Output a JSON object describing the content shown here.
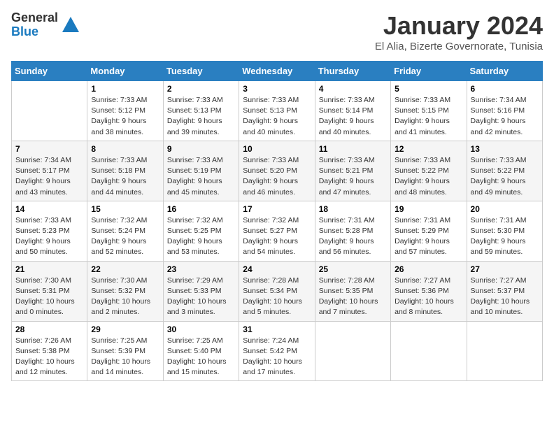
{
  "header": {
    "logo": {
      "general": "General",
      "blue": "Blue"
    },
    "title": "January 2024",
    "location": "El Alia, Bizerte Governorate, Tunisia"
  },
  "weekdays": [
    "Sunday",
    "Monday",
    "Tuesday",
    "Wednesday",
    "Thursday",
    "Friday",
    "Saturday"
  ],
  "weeks": [
    [
      {
        "day": "",
        "sunrise": "",
        "sunset": "",
        "daylight": "",
        "empty": true
      },
      {
        "day": "1",
        "sunrise": "Sunrise: 7:33 AM",
        "sunset": "Sunset: 5:12 PM",
        "daylight": "Daylight: 9 hours and 38 minutes."
      },
      {
        "day": "2",
        "sunrise": "Sunrise: 7:33 AM",
        "sunset": "Sunset: 5:13 PM",
        "daylight": "Daylight: 9 hours and 39 minutes."
      },
      {
        "day": "3",
        "sunrise": "Sunrise: 7:33 AM",
        "sunset": "Sunset: 5:13 PM",
        "daylight": "Daylight: 9 hours and 40 minutes."
      },
      {
        "day": "4",
        "sunrise": "Sunrise: 7:33 AM",
        "sunset": "Sunset: 5:14 PM",
        "daylight": "Daylight: 9 hours and 40 minutes."
      },
      {
        "day": "5",
        "sunrise": "Sunrise: 7:33 AM",
        "sunset": "Sunset: 5:15 PM",
        "daylight": "Daylight: 9 hours and 41 minutes."
      },
      {
        "day": "6",
        "sunrise": "Sunrise: 7:34 AM",
        "sunset": "Sunset: 5:16 PM",
        "daylight": "Daylight: 9 hours and 42 minutes."
      }
    ],
    [
      {
        "day": "7",
        "sunrise": "Sunrise: 7:34 AM",
        "sunset": "Sunset: 5:17 PM",
        "daylight": "Daylight: 9 hours and 43 minutes."
      },
      {
        "day": "8",
        "sunrise": "Sunrise: 7:33 AM",
        "sunset": "Sunset: 5:18 PM",
        "daylight": "Daylight: 9 hours and 44 minutes."
      },
      {
        "day": "9",
        "sunrise": "Sunrise: 7:33 AM",
        "sunset": "Sunset: 5:19 PM",
        "daylight": "Daylight: 9 hours and 45 minutes."
      },
      {
        "day": "10",
        "sunrise": "Sunrise: 7:33 AM",
        "sunset": "Sunset: 5:20 PM",
        "daylight": "Daylight: 9 hours and 46 minutes."
      },
      {
        "day": "11",
        "sunrise": "Sunrise: 7:33 AM",
        "sunset": "Sunset: 5:21 PM",
        "daylight": "Daylight: 9 hours and 47 minutes."
      },
      {
        "day": "12",
        "sunrise": "Sunrise: 7:33 AM",
        "sunset": "Sunset: 5:22 PM",
        "daylight": "Daylight: 9 hours and 48 minutes."
      },
      {
        "day": "13",
        "sunrise": "Sunrise: 7:33 AM",
        "sunset": "Sunset: 5:22 PM",
        "daylight": "Daylight: 9 hours and 49 minutes."
      }
    ],
    [
      {
        "day": "14",
        "sunrise": "Sunrise: 7:33 AM",
        "sunset": "Sunset: 5:23 PM",
        "daylight": "Daylight: 9 hours and 50 minutes."
      },
      {
        "day": "15",
        "sunrise": "Sunrise: 7:32 AM",
        "sunset": "Sunset: 5:24 PM",
        "daylight": "Daylight: 9 hours and 52 minutes."
      },
      {
        "day": "16",
        "sunrise": "Sunrise: 7:32 AM",
        "sunset": "Sunset: 5:25 PM",
        "daylight": "Daylight: 9 hours and 53 minutes."
      },
      {
        "day": "17",
        "sunrise": "Sunrise: 7:32 AM",
        "sunset": "Sunset: 5:27 PM",
        "daylight": "Daylight: 9 hours and 54 minutes."
      },
      {
        "day": "18",
        "sunrise": "Sunrise: 7:31 AM",
        "sunset": "Sunset: 5:28 PM",
        "daylight": "Daylight: 9 hours and 56 minutes."
      },
      {
        "day": "19",
        "sunrise": "Sunrise: 7:31 AM",
        "sunset": "Sunset: 5:29 PM",
        "daylight": "Daylight: 9 hours and 57 minutes."
      },
      {
        "day": "20",
        "sunrise": "Sunrise: 7:31 AM",
        "sunset": "Sunset: 5:30 PM",
        "daylight": "Daylight: 9 hours and 59 minutes."
      }
    ],
    [
      {
        "day": "21",
        "sunrise": "Sunrise: 7:30 AM",
        "sunset": "Sunset: 5:31 PM",
        "daylight": "Daylight: 10 hours and 0 minutes."
      },
      {
        "day": "22",
        "sunrise": "Sunrise: 7:30 AM",
        "sunset": "Sunset: 5:32 PM",
        "daylight": "Daylight: 10 hours and 2 minutes."
      },
      {
        "day": "23",
        "sunrise": "Sunrise: 7:29 AM",
        "sunset": "Sunset: 5:33 PM",
        "daylight": "Daylight: 10 hours and 3 minutes."
      },
      {
        "day": "24",
        "sunrise": "Sunrise: 7:28 AM",
        "sunset": "Sunset: 5:34 PM",
        "daylight": "Daylight: 10 hours and 5 minutes."
      },
      {
        "day": "25",
        "sunrise": "Sunrise: 7:28 AM",
        "sunset": "Sunset: 5:35 PM",
        "daylight": "Daylight: 10 hours and 7 minutes."
      },
      {
        "day": "26",
        "sunrise": "Sunrise: 7:27 AM",
        "sunset": "Sunset: 5:36 PM",
        "daylight": "Daylight: 10 hours and 8 minutes."
      },
      {
        "day": "27",
        "sunrise": "Sunrise: 7:27 AM",
        "sunset": "Sunset: 5:37 PM",
        "daylight": "Daylight: 10 hours and 10 minutes."
      }
    ],
    [
      {
        "day": "28",
        "sunrise": "Sunrise: 7:26 AM",
        "sunset": "Sunset: 5:38 PM",
        "daylight": "Daylight: 10 hours and 12 minutes."
      },
      {
        "day": "29",
        "sunrise": "Sunrise: 7:25 AM",
        "sunset": "Sunset: 5:39 PM",
        "daylight": "Daylight: 10 hours and 14 minutes."
      },
      {
        "day": "30",
        "sunrise": "Sunrise: 7:25 AM",
        "sunset": "Sunset: 5:40 PM",
        "daylight": "Daylight: 10 hours and 15 minutes."
      },
      {
        "day": "31",
        "sunrise": "Sunrise: 7:24 AM",
        "sunset": "Sunset: 5:42 PM",
        "daylight": "Daylight: 10 hours and 17 minutes."
      },
      {
        "day": "",
        "empty": true
      },
      {
        "day": "",
        "empty": true
      },
      {
        "day": "",
        "empty": true
      }
    ]
  ]
}
